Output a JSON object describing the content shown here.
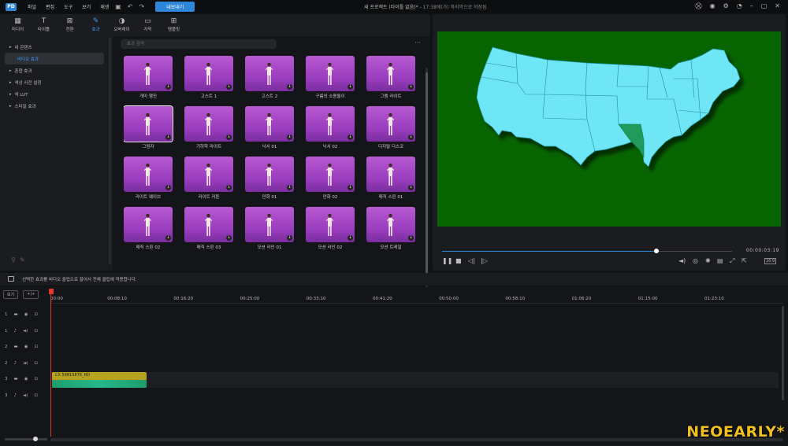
{
  "topbar": {
    "logo": "PD",
    "menus": [
      "파일",
      "편집",
      "도구",
      "보기",
      "재생"
    ],
    "export_label": "내보내기",
    "project_title": "새 프로젝트 (타이틀 없음)*",
    "saved_text": "17:38에(가) 마지막으로 저장됨"
  },
  "tabs": [
    {
      "label": "미디어",
      "icon": "media-icon"
    },
    {
      "label": "타이틀",
      "icon": "title-icon"
    },
    {
      "label": "전환",
      "icon": "transition-icon"
    },
    {
      "label": "효과",
      "icon": "effect-icon",
      "active": true
    },
    {
      "label": "오버레이",
      "icon": "overlay-icon"
    },
    {
      "label": "자막",
      "icon": "subtitle-icon"
    },
    {
      "label": "템플릿",
      "icon": "template-icon"
    }
  ],
  "tree": [
    {
      "label": "내 콘텐츠",
      "expanded": true
    },
    {
      "label": "비디오 효과",
      "selected": true
    },
    {
      "label": "혼합 효과"
    },
    {
      "label": "색상 사전 설정"
    },
    {
      "label": "색 LUT"
    },
    {
      "label": "스타일 효과"
    }
  ],
  "search": {
    "placeholder": "효과 검색"
  },
  "effects": [
    [
      "개미 행진",
      "고스트 1",
      "고스트 2",
      "구름의 소용돌이",
      "그렘 라이트"
    ],
    [
      "그림자",
      "기하학 라이트",
      "낙서 01",
      "낙서 02",
      "디지털 디스코"
    ],
    [
      "라이트 웨이브",
      "라이트 커튼",
      "만화 01",
      "만화 02",
      "매직 스핀 01"
    ],
    [
      "매직 스핀 02",
      "매직 스핀 03",
      "모션 라인 01",
      "모션 라인 02",
      "모션 트레일"
    ]
  ],
  "preview": {
    "timecode": "00:00:03:19",
    "progress": 0.74,
    "ratio": "16:9"
  },
  "hint": "선택한 효과를 비디오 클립으로 끌어서 전체 클립에 적용합니다.",
  "timeline": {
    "ticks": [
      "00:00",
      "00:08:10",
      "00:16:20",
      "00:25:00",
      "00:33:10",
      "00:41:20",
      "00:50:00",
      "00:58:10",
      "01:06:20",
      "01:15:00",
      "01:23:10"
    ],
    "tracks": [
      {
        "num": "1",
        "type": "video"
      },
      {
        "num": "1",
        "type": "audio"
      },
      {
        "num": "2",
        "type": "video"
      },
      {
        "num": "2",
        "type": "audio"
      },
      {
        "num": "3",
        "type": "video"
      },
      {
        "num": "3",
        "type": "audio"
      }
    ],
    "clip_name": "CX 59815876_HD",
    "tools": [
      "보기",
      "+|+"
    ]
  },
  "watermark": "NEOEARLY*",
  "colors": {
    "accent": "#2d86d8",
    "screen_bg": "#076500",
    "map_fill": "#6ee6f5",
    "clip": "#b8a320"
  }
}
